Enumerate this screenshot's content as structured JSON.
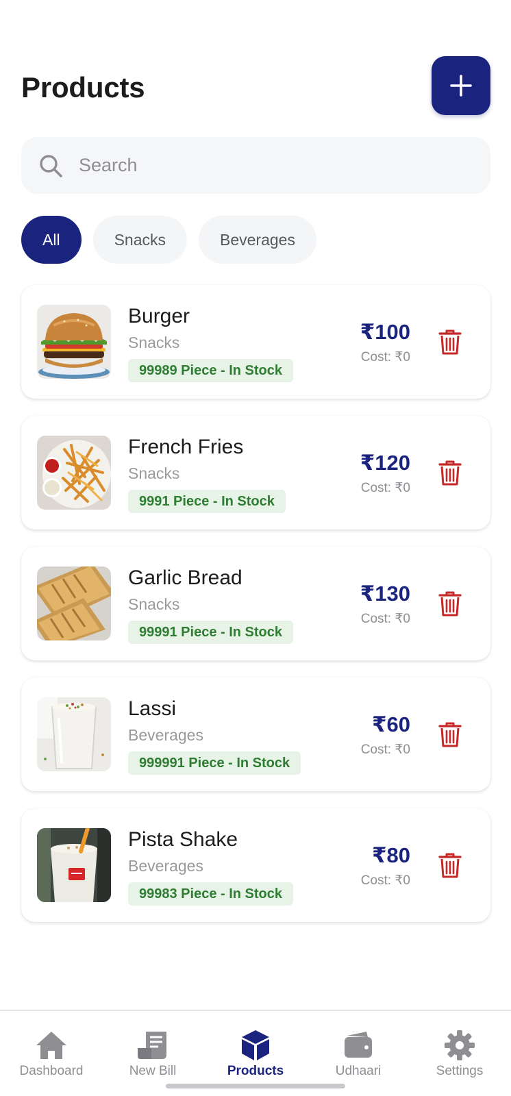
{
  "header": {
    "title": "Products"
  },
  "search": {
    "placeholder": "Search"
  },
  "filters": [
    "All",
    "Snacks",
    "Beverages"
  ],
  "products": [
    {
      "name": "Burger",
      "category": "Snacks",
      "stock": "99989 Piece - In Stock",
      "price": "₹100",
      "cost": "Cost: ₹0"
    },
    {
      "name": "French Fries",
      "category": "Snacks",
      "stock": "9991 Piece - In Stock",
      "price": "₹120",
      "cost": "Cost: ₹0"
    },
    {
      "name": "Garlic Bread",
      "category": "Snacks",
      "stock": "99991 Piece - In Stock",
      "price": "₹130",
      "cost": "Cost: ₹0"
    },
    {
      "name": "Lassi",
      "category": "Beverages",
      "stock": "999991 Piece - In Stock",
      "price": "₹60",
      "cost": "Cost: ₹0"
    },
    {
      "name": "Pista Shake",
      "category": "Beverages",
      "stock": "99983 Piece - In Stock",
      "price": "₹80",
      "cost": "Cost: ₹0"
    }
  ],
  "nav": [
    {
      "label": "Dashboard",
      "icon": "home-icon"
    },
    {
      "label": "New Bill",
      "icon": "receipt-icon"
    },
    {
      "label": "Products",
      "icon": "cube-icon"
    },
    {
      "label": "Udhaari",
      "icon": "wallet-icon"
    },
    {
      "label": "Settings",
      "icon": "gear-icon"
    }
  ],
  "colors": {
    "primary": "#1a237e",
    "stock_green": "#2e7d32",
    "stock_bg": "#e6f3e6",
    "delete_red": "#c62828",
    "muted": "#8e8e93"
  }
}
